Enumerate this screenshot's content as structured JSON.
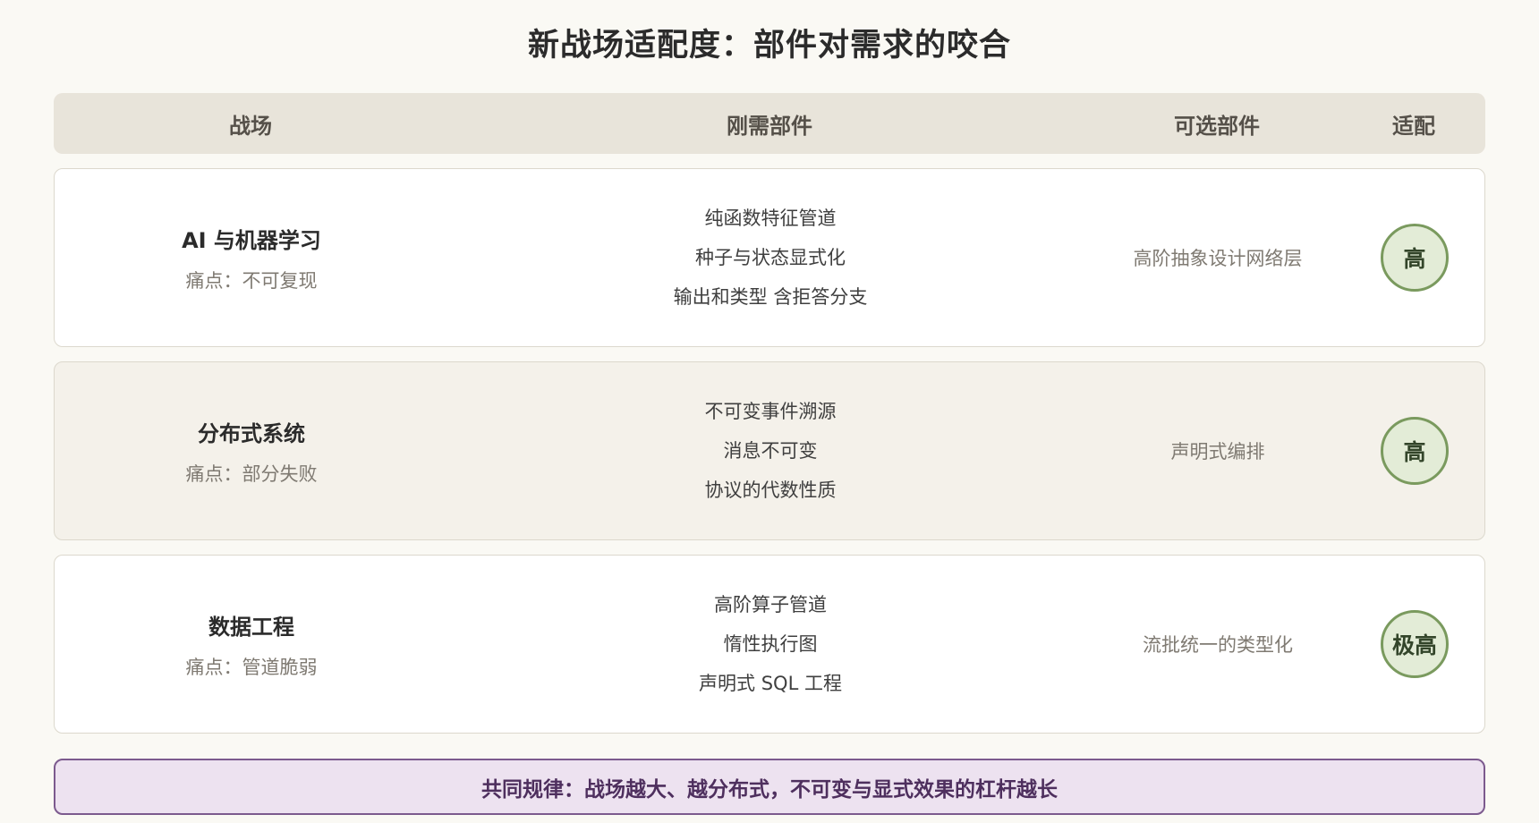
{
  "title": "新战场适配度：部件对需求的咬合",
  "header": {
    "battlefield": "战场",
    "required": "刚需部件",
    "optional": "可选部件",
    "fit": "适配"
  },
  "rows": [
    {
      "name": "AI 与机器学习",
      "pain": "痛点：不可复现",
      "required": [
        "纯函数特征管道",
        "种子与状态显式化",
        "输出和类型 含拒答分支"
      ],
      "optional": "高阶抽象设计网络层",
      "fit": "高"
    },
    {
      "name": "分布式系统",
      "pain": "痛点：部分失败",
      "required": [
        "不可变事件溯源",
        "消息不可变",
        "协议的代数性质"
      ],
      "optional": "声明式编排",
      "fit": "高"
    },
    {
      "name": "数据工程",
      "pain": "痛点：管道脆弱",
      "required": [
        "高阶算子管道",
        "惰性执行图",
        "声明式 SQL 工程"
      ],
      "optional": "流批统一的类型化",
      "fit": "极高"
    }
  ],
  "footer": "共同规律：战场越大、越分布式，不可变与显式效果的杠杆越长",
  "colors": {
    "background": "#faf9f4",
    "header_bg": "#e8e4da",
    "badge_border": "#7a9a5e",
    "badge_bg": "#e3ecd7",
    "footer_border": "#7c5a8e",
    "footer_bg": "#ede2f0"
  }
}
